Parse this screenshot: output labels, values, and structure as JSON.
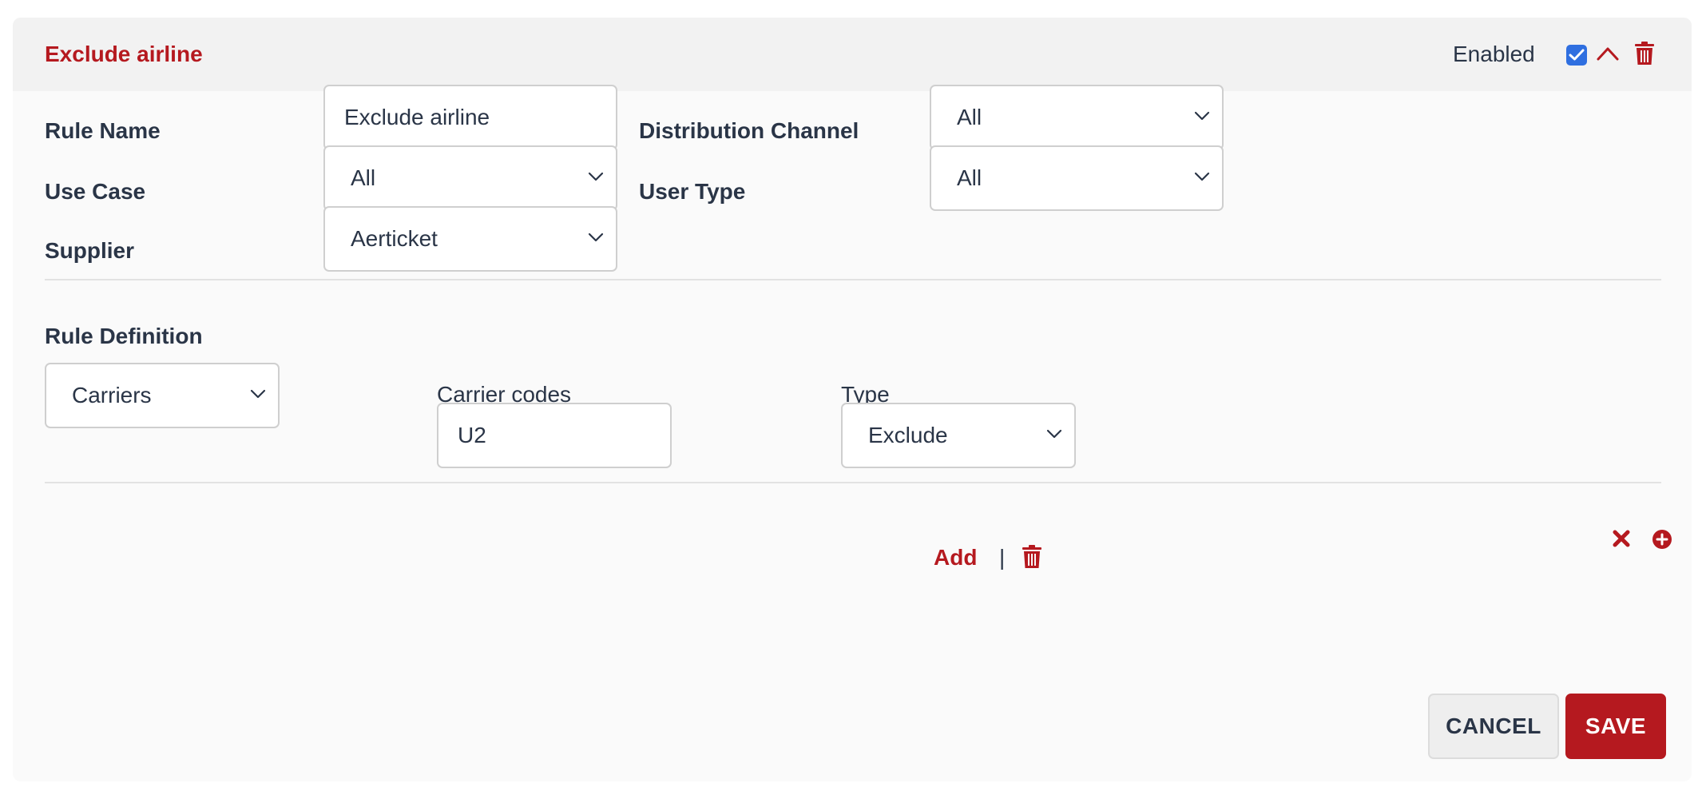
{
  "header": {
    "title": "Exclude airline",
    "enabled_label": "Enabled",
    "enabled_checked": true
  },
  "form": {
    "rule_name": {
      "label": "Rule Name",
      "value": "Exclude airline"
    },
    "distribution_channel": {
      "label": "Distribution Channel",
      "value": "All"
    },
    "use_case": {
      "label": "Use Case",
      "value": "All"
    },
    "user_type": {
      "label": "User Type",
      "value": "All"
    },
    "supplier": {
      "label": "Supplier",
      "value": "Aerticket"
    }
  },
  "rule_definition": {
    "heading": "Rule Definition",
    "condition": {
      "value": "Carriers"
    },
    "carrier_codes": {
      "label": "Carrier codes",
      "value": "U2"
    },
    "add_label": "Add",
    "separator": "|",
    "type": {
      "label": "Type",
      "value": "Exclude"
    }
  },
  "actions": {
    "cancel_label": "CANCEL",
    "save_label": "SAVE"
  },
  "colors": {
    "accent": "#b5191f",
    "checkbox": "#2f6fe0",
    "text": "#2a3547"
  }
}
